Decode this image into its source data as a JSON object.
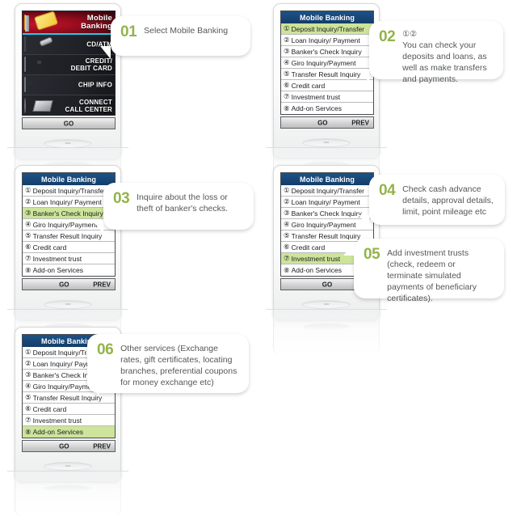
{
  "menu_screen": {
    "header": "Mobile Banking",
    "items": [
      {
        "num": "①",
        "label": "Deposit Inquiry/Transfer"
      },
      {
        "num": "②",
        "label": "Loan Inquiry/ Payment"
      },
      {
        "num": "③",
        "label": "Banker's Check Inquiry"
      },
      {
        "num": "④",
        "label": "Giro Inquiry/Payment"
      },
      {
        "num": "⑤",
        "label": "Transfer Result Inquiry"
      },
      {
        "num": "⑥",
        "label": "Credit card"
      },
      {
        "num": "⑦",
        "label": "Investment trust"
      },
      {
        "num": "⑧",
        "label": "Add-on Services"
      }
    ],
    "go_label": "GO",
    "prev_label": "PREV"
  },
  "image_screen": {
    "rows": [
      {
        "label": "Mobile\nBanking",
        "icon": "credit-cards-icon"
      },
      {
        "label": "CD/ATM",
        "icon": "atm-machine-icon"
      },
      {
        "label": "CREDIT/\nDEBIT CARD",
        "icon": "card-reader-icon"
      },
      {
        "label": "CHIP INFO",
        "icon": "chip-device-icon"
      },
      {
        "label": "CONNECT\nCALL CENTER",
        "icon": "call-center-agent-icon"
      }
    ],
    "go_label": "GO"
  },
  "accent_color": "#94b34a",
  "header_color": "#15416f",
  "highlight_color": "#cde49a",
  "panels": [
    {
      "id": "panel-01",
      "screen": "image",
      "highlight_index": 0,
      "callout": {
        "number": "01",
        "pre": "",
        "text": "Select Mobile Banking"
      }
    },
    {
      "id": "panel-02",
      "screen": "list",
      "highlight_index": 0,
      "callout": {
        "number": "02",
        "pre": "①②",
        "text": "You can check your deposits and loans, as well as make transfers and payments."
      }
    },
    {
      "id": "panel-03",
      "screen": "list",
      "highlight_index": 2,
      "callout": {
        "number": "03",
        "pre": "",
        "text": "Inquire about the loss or theft of banker's checks."
      }
    },
    {
      "id": "panel-04",
      "screen": "list",
      "highlight_index": 6,
      "callout": {
        "number": "04",
        "pre": "",
        "text": "Check cash advance details, approval details, limit, point mileage etc"
      }
    },
    {
      "id": "panel-05",
      "screen": "list",
      "callout": {
        "number": "05",
        "pre": "",
        "text": "Add investment trusts (check, redeem or terminate simulated payments of beneficiary certificates)."
      }
    },
    {
      "id": "panel-06",
      "screen": "list",
      "highlight_index": 7,
      "callout": {
        "number": "06",
        "pre": "",
        "text": "Other services (Exchange rates, gift certificates, locating branches, preferential coupons for money exchange etc)"
      }
    }
  ]
}
